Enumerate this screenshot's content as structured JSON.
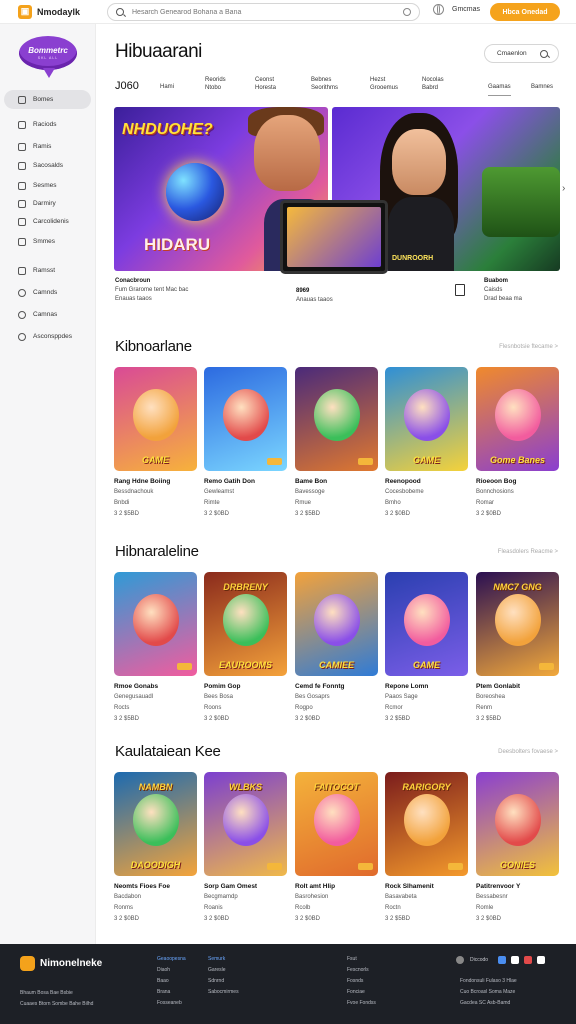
{
  "topbar": {
    "brand": "Nmodaylk",
    "search_placeholder": "Hesarch Genearod Bohana a Bana",
    "language": "Gmcmas",
    "cta": "Hbca Onedad"
  },
  "sidebar": {
    "logo": "Bommetrc",
    "logo_sub": "SKL ALL",
    "items": [
      {
        "label": "Bomes",
        "icon": "home-icon"
      },
      {
        "label": "Raciods",
        "icon": "grid-icon"
      },
      {
        "label": "Ramis",
        "icon": "flag-icon"
      },
      {
        "label": "Sacosalds",
        "icon": "list-icon"
      },
      {
        "label": "Sesmes",
        "icon": "folder-icon"
      },
      {
        "label": "Darmiry",
        "icon": "box-icon"
      },
      {
        "label": "Carcolidenis",
        "icon": "calendar-icon"
      },
      {
        "label": "Smmes",
        "icon": "bookmark-icon"
      },
      {
        "label": "Ramsst",
        "icon": "gift-icon"
      },
      {
        "label": "Camnds",
        "icon": "clock-icon"
      },
      {
        "label": "Camnas",
        "icon": "search-icon"
      },
      {
        "label": "Asconsppdes",
        "icon": "settings-icon"
      }
    ]
  },
  "header": {
    "title": "Hibuaarani",
    "filter_label": "Cmaenlon",
    "tabs": [
      {
        "label": "J060"
      },
      {
        "label": "Hami"
      },
      {
        "label": "Reorids\nNtobo"
      },
      {
        "label": "Ceonst\nHoresta"
      },
      {
        "label": "Bebnes\nSeorithms"
      },
      {
        "label": "Hezst\nGrooemus"
      },
      {
        "label": "Nocolas\nBabrd"
      },
      {
        "label": "Gaamas"
      },
      {
        "label": "Bamnes"
      }
    ]
  },
  "hero": {
    "banner_a_title": "NHDUOHE?",
    "banner_a_bottom": "HIDARU",
    "banner_b_title": "DUNROORH",
    "meta_left": {
      "title": "Conacbroun",
      "line1": "Fum Grarome tent Mac bac",
      "line2": "Enauas taaos"
    },
    "meta_mid": {
      "title": "8969",
      "line1": "Anauas taaos"
    },
    "meta_right": {
      "title": "Buabom",
      "line1": "Caisds",
      "line2": "Drad beaa ma"
    }
  },
  "sections": [
    {
      "title": "Kibnoarlane",
      "see_all": "Flesnbotsie ftecame  >",
      "cards": [
        {
          "caption": "GAME",
          "top": "",
          "title": "Rang Hdne Boiing",
          "line1": "Bessdnachouk",
          "line2": "Bnbdi",
          "line3": "3 2 $5BD"
        },
        {
          "caption": "",
          "top": "",
          "title": "Remo Gatih Don",
          "line1": "Gewleamst",
          "line2": "Rimte",
          "line3": "3 2 $0BD"
        },
        {
          "caption": "",
          "top": "",
          "title": "Bame Bon",
          "line1": "Bavessoge",
          "line2": "Rmue",
          "line3": "3 2 $5BD"
        },
        {
          "caption": "GAME",
          "top": "",
          "title": "Reenopood",
          "line1": "Cocesbobeme",
          "line2": "Bmho",
          "line3": "3 2 $0BD"
        },
        {
          "caption": "Gome Banes",
          "top": "",
          "title": "Rioeoon Bog",
          "line1": "Bonnchosions",
          "line2": "Romar",
          "line3": "3 2 $0BD"
        }
      ]
    },
    {
      "title": "Hibnaraleline",
      "see_all": "Fleasdolers Reacme  >",
      "cards": [
        {
          "caption": "",
          "top": "",
          "title": "Rmoe Gonabs",
          "line1": "Genegusauadl",
          "line2": "Rocts",
          "line3": "3 2 $5BD"
        },
        {
          "caption": "EAUROOMS",
          "top": "DRBRENY",
          "title": "Pomim Gop",
          "line1": "Bees Bosa",
          "line2": "Roons",
          "line3": "3 2 $0BD"
        },
        {
          "caption": "CAMIEE",
          "top": "",
          "title": "Cemd fe Fonntg",
          "line1": "Bes Gosaprs",
          "line2": "Rogpo",
          "line3": "3 2 $0BD"
        },
        {
          "caption": "GAME",
          "top": "",
          "title": "Repone Lomn",
          "line1": "Paaos Sage",
          "line2": "Rcmor",
          "line3": "3 2 $5BD"
        },
        {
          "caption": "",
          "top": "NMC7 GNG",
          "title": "Ptem Gonlabit",
          "line1": "Boreoshea",
          "line2": "Renm",
          "line3": "3 2 $5BD"
        }
      ]
    },
    {
      "title": "Kaulataiean Kee",
      "see_all": "Deesbolters fovaese  >",
      "cards": [
        {
          "caption": "DAOODIGH",
          "top": "NAMBN",
          "title": "Neomts Fioes Foe",
          "line1": "Bacdabon",
          "line2": "Ronms",
          "line3": "3 2 $0BD"
        },
        {
          "caption": "",
          "top": "WLBKS",
          "title": "Sorp Gam Omest",
          "line1": "Becgmamdp",
          "line2": "Roanis",
          "line3": "3 2 $0BD"
        },
        {
          "caption": "",
          "top": "FAITOCOT",
          "title": "Rolt amt Hlip",
          "line1": "Basrohesion",
          "line2": "Rcolb",
          "line3": "3 2 $0BD"
        },
        {
          "caption": "",
          "top": "RARIGORY",
          "title": "Rock Slhamenit",
          "line1": "Basavabeta",
          "line2": "Roctn",
          "line3": "3 2 $5BD"
        },
        {
          "caption": "GONIES",
          "top": "",
          "title": "Patitrenvoor Y",
          "line1": "Bessabesnr",
          "line2": "Romle",
          "line3": "3 2 $0BD"
        }
      ]
    }
  ],
  "footer": {
    "brand": "Nimonelneke",
    "left_text": [
      "Bhaum Bosa Bae Bsbie",
      "Cuaaes Btorn Sombe Bahe Bilhd"
    ],
    "col1": [
      "Geaoopesna",
      "Diaoh",
      "Baao",
      "Brana",
      "Fosseaneb"
    ],
    "col2": [
      "Semurk",
      "Garesle",
      "Sdnrnd",
      "Sabocmirmes"
    ],
    "col3": [
      "Fsut",
      "Fescnorls",
      "Fosnds",
      "Fonciae",
      "Fvoe Fondss"
    ],
    "socials_label": "Diccodo",
    "right_text": [
      "Fondonsuli Fulaso 3 Hlae",
      "Cuo Bcroasl Soma Maze",
      "Gacdea SC Asb-Bamd"
    ]
  }
}
